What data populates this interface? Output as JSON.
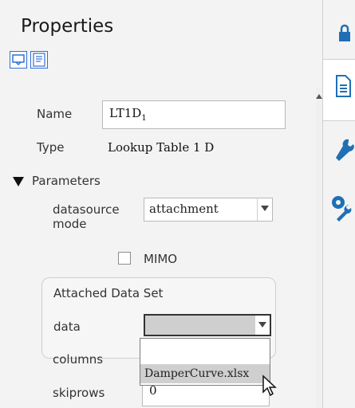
{
  "panel": {
    "title": "Properties",
    "toolbar": [
      {
        "icon": "display-options-icon"
      },
      {
        "icon": "text-view-icon"
      }
    ]
  },
  "fields": {
    "name_label": "Name",
    "name_value": "LT1D",
    "name_subscript": "1",
    "type_label": "Type",
    "type_value": "Lookup Table 1 D"
  },
  "parameters": {
    "section_label": "Parameters",
    "datasource_label_line1": "datasource",
    "datasource_label_line2": "mode",
    "datasource_value": "attachment",
    "mimo_label": "MIMO",
    "mimo_checked": false,
    "group_title": "Attached Data Set",
    "data_label": "data",
    "data_value": "",
    "data_options": [
      "",
      "DamperCurve.xlsx"
    ],
    "columns_label": "columns",
    "skiprows_label": "skiprows",
    "skiprows_value": "0"
  },
  "right_toolbar": [
    {
      "icon": "lock-icon"
    },
    {
      "icon": "document-icon"
    },
    {
      "icon": "wrench-icon"
    },
    {
      "icon": "settings-wrench-icon"
    }
  ],
  "colors": {
    "accent_blue": "#2f6fd6",
    "icon_blue": "#1f6fb5",
    "selection_bg": "#cfcfcf"
  }
}
